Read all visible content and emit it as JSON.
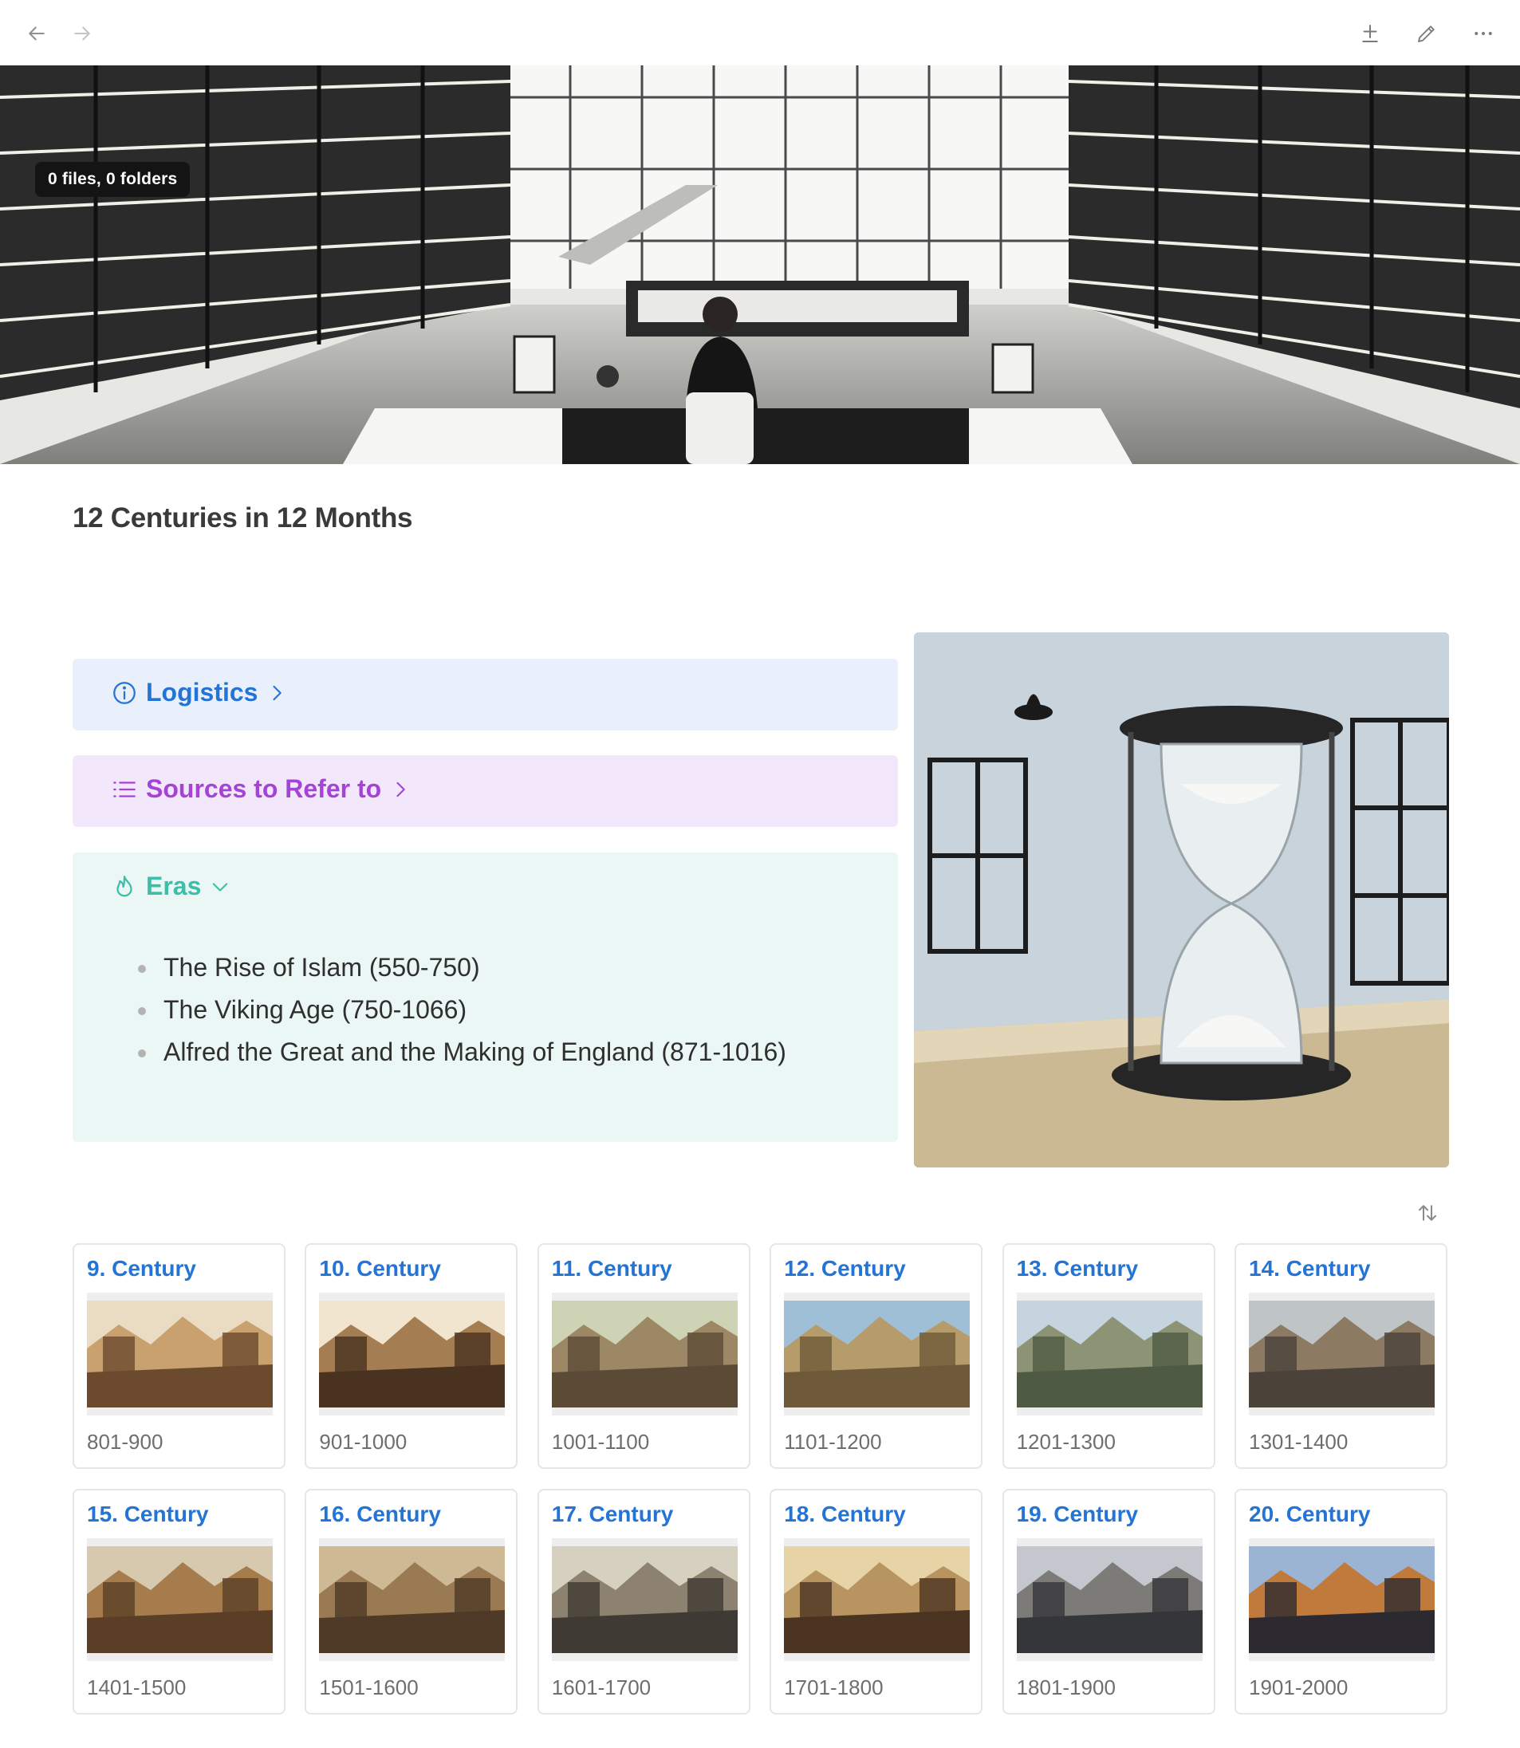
{
  "toolbar": {
    "back_icon": "arrow-left-icon",
    "forward_icon": "arrow-right-icon",
    "add_icon": "plus-icon",
    "edit_icon": "pencil-icon",
    "more_icon": "more-horizontal-icon"
  },
  "banner": {
    "files_badge": "0 files, 0 folders"
  },
  "page": {
    "title": "12 Centuries in 12 Months"
  },
  "callouts": {
    "logistics": {
      "label": "Logistics",
      "icon": "info-icon",
      "color": "#2474d5"
    },
    "sources": {
      "label": "Sources to Refer to",
      "icon": "list-icon",
      "color": "#a443d6"
    },
    "eras": {
      "label": "Eras",
      "icon": "flame-icon",
      "color": "#3cbfa8",
      "items": [
        "The Rise of Islam (550-750)",
        "The Viking Age (750-1066)",
        "Alfred the Great and the Making of England (871-1016)"
      ]
    }
  },
  "gallery": {
    "sort_icon": "sort-arrows-icon",
    "cards": [
      {
        "title": "9. Century",
        "range": "801-900"
      },
      {
        "title": "10. Century",
        "range": "901-1000"
      },
      {
        "title": "11. Century",
        "range": "1001-1100"
      },
      {
        "title": "12. Century",
        "range": "1101-1200"
      },
      {
        "title": "13. Century",
        "range": "1201-1300"
      },
      {
        "title": "14. Century",
        "range": "1301-1400"
      },
      {
        "title": "15. Century",
        "range": "1401-1500"
      },
      {
        "title": "16. Century",
        "range": "1501-1600"
      },
      {
        "title": "17. Century",
        "range": "1601-1700"
      },
      {
        "title": "18. Century",
        "range": "1701-1800"
      },
      {
        "title": "19. Century",
        "range": "1801-1900"
      },
      {
        "title": "20. Century",
        "range": "1901-2000"
      }
    ]
  }
}
